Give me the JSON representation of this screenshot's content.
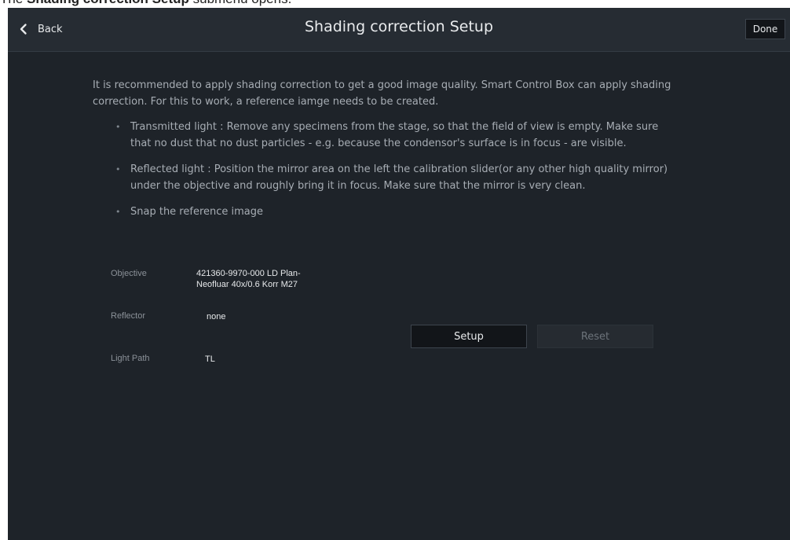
{
  "caption": {
    "prefix": "The ",
    "bold": "Shading correction Setup",
    "suffix": " submenu opens."
  },
  "header": {
    "back_label": "Back",
    "title": "Shading correction Setup",
    "done_label": "Done"
  },
  "content": {
    "intro": "It is recommended to apply shading correction to get a good image quality. Smart Control Box can apply shading correction. For this to work, a reference iamge needs to be created.",
    "bullets": [
      "Transmitted light : Remove any specimens from the stage, so that the field of view is empty. Make sure that no dust that no dust particles - e.g. because the condensor's surface is in focus - are visible.",
      "Reflected light : Position the mirror area on the left the calibration slider(or any other high quality mirror) under the objective and roughly bring it in focus. Make sure that the mirror is very clean.",
      "Snap the reference image"
    ]
  },
  "settings": {
    "objective_label": "Objective",
    "objective_value": "421360-9970-000 LD Plan-Neofluar 40x/0.6 Korr M27",
    "reflector_label": "Reflector",
    "reflector_value": "none",
    "light_path_label": "Light Path",
    "light_path_value": "TL"
  },
  "actions": {
    "setup_label": "Setup",
    "reset_label": "Reset"
  },
  "icons": {
    "back": "chevron-left-icon"
  },
  "colors": {
    "background": "#1e2329",
    "header": "#262c33",
    "button_dark": "#121519",
    "button_disabled": "#262b31",
    "text_primary": "#e9ebed",
    "text_secondary": "#a7adb4"
  }
}
